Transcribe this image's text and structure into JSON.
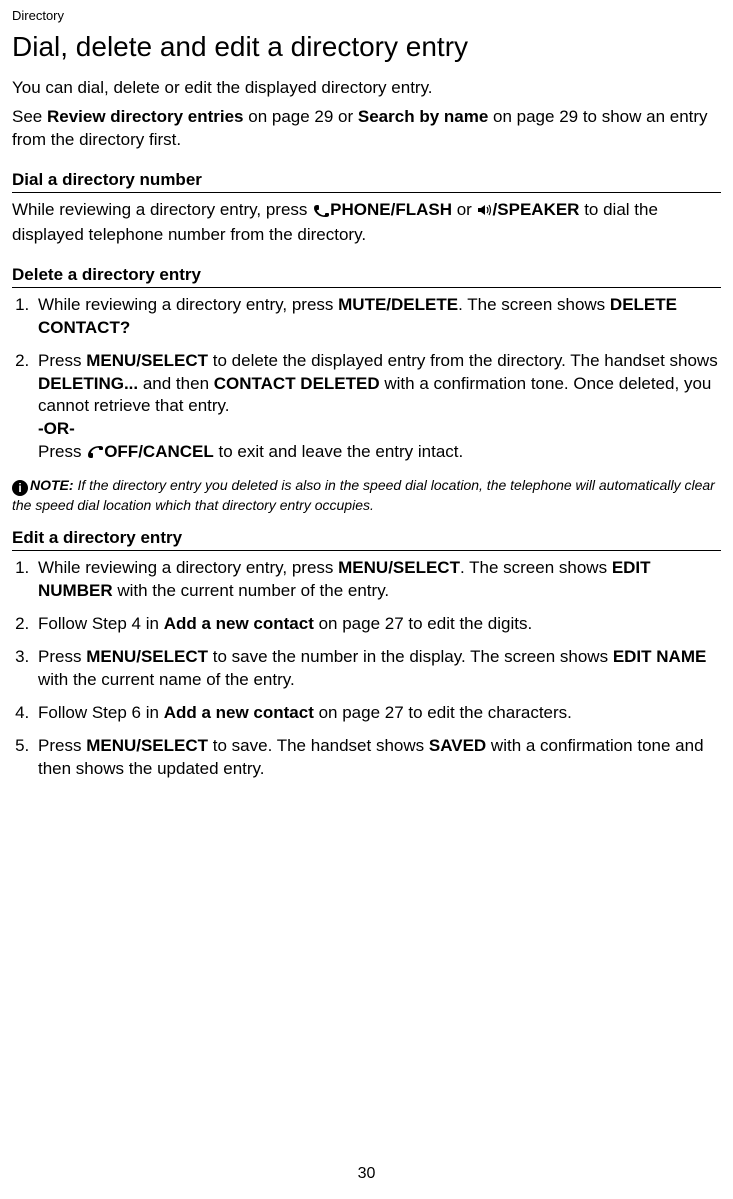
{
  "breadcrumb": "Directory",
  "title": "Dial, delete and edit a directory entry",
  "intro": "You can dial, delete or edit the displayed directory entry.",
  "see_prefix": "See ",
  "see_link1": "Review directory entries",
  "see_mid1": " on page 29 or ",
  "see_link2": "Search by name",
  "see_suffix": " on page 29 to show an entry from the directory first.",
  "dial": {
    "heading": "Dial a directory number",
    "p1_a": "While reviewing a directory entry, press ",
    "p1_phone": "PHONE/",
    "p1_flash": "FLASH",
    "p1_or": " or ",
    "p1_speaker": "/SPEAKER",
    "p1_b": " to dial the displayed telephone number from the directory."
  },
  "delete": {
    "heading": "Delete a directory entry",
    "li1_a": "While reviewing a directory entry, press ",
    "li1_mute": "MUTE",
    "li1_delete": "/DELETE",
    "li1_b": ". The screen shows ",
    "li1_c": "DELETE CONTACT?",
    "li2_a": "Press ",
    "li2_menu": "MENU",
    "li2_select": "/SELECT",
    "li2_b": " to delete the displayed entry from the directory. The handset shows ",
    "li2_c": "DELETING...",
    "li2_d": " and then ",
    "li2_e": "CONTACT DELETED",
    "li2_f": " with a confirmation tone. Once deleted, you cannot retrieve that entry.",
    "li2_or": "-OR-",
    "li2_g": "Press ",
    "li2_off": "OFF",
    "li2_cancel": "/CANCEL",
    "li2_h": " to exit and leave the entry intact."
  },
  "note": {
    "label": "NOTE:",
    "text": " If the directory entry you deleted is also in the speed dial location, the telephone will automatically clear the speed dial location which that directory entry occupies."
  },
  "edit": {
    "heading": "Edit a directory entry",
    "li1_a": "While reviewing a directory entry, press ",
    "li1_menu": "MENU",
    "li1_select": "/SELECT",
    "li1_b": ". The screen shows ",
    "li1_c": "EDIT NUMBER",
    "li1_d": " with the current number of the entry.",
    "li2_a": "Follow Step 4 in ",
    "li2_b": "Add a new contact",
    "li2_c": " on page 27 to edit the digits.",
    "li3_a": "Press ",
    "li3_menu": "MENU",
    "li3_select": "/SELECT",
    "li3_b": " to save the number in the display. The screen shows ",
    "li3_c": "EDIT NAME",
    "li3_d": " with the current name of the entry.",
    "li4_a": "Follow Step 6 in ",
    "li4_b": "Add a new contact",
    "li4_c": " on page 27 to edit the characters.",
    "li5_a": "Press ",
    "li5_menu": "MENU",
    "li5_select": "/SELECT",
    "li5_b": " to save. The handset shows ",
    "li5_c": "SAVED",
    "li5_d": " with a confirmation tone and then shows the updated entry."
  },
  "page_number": "30",
  "info_glyph": "i"
}
